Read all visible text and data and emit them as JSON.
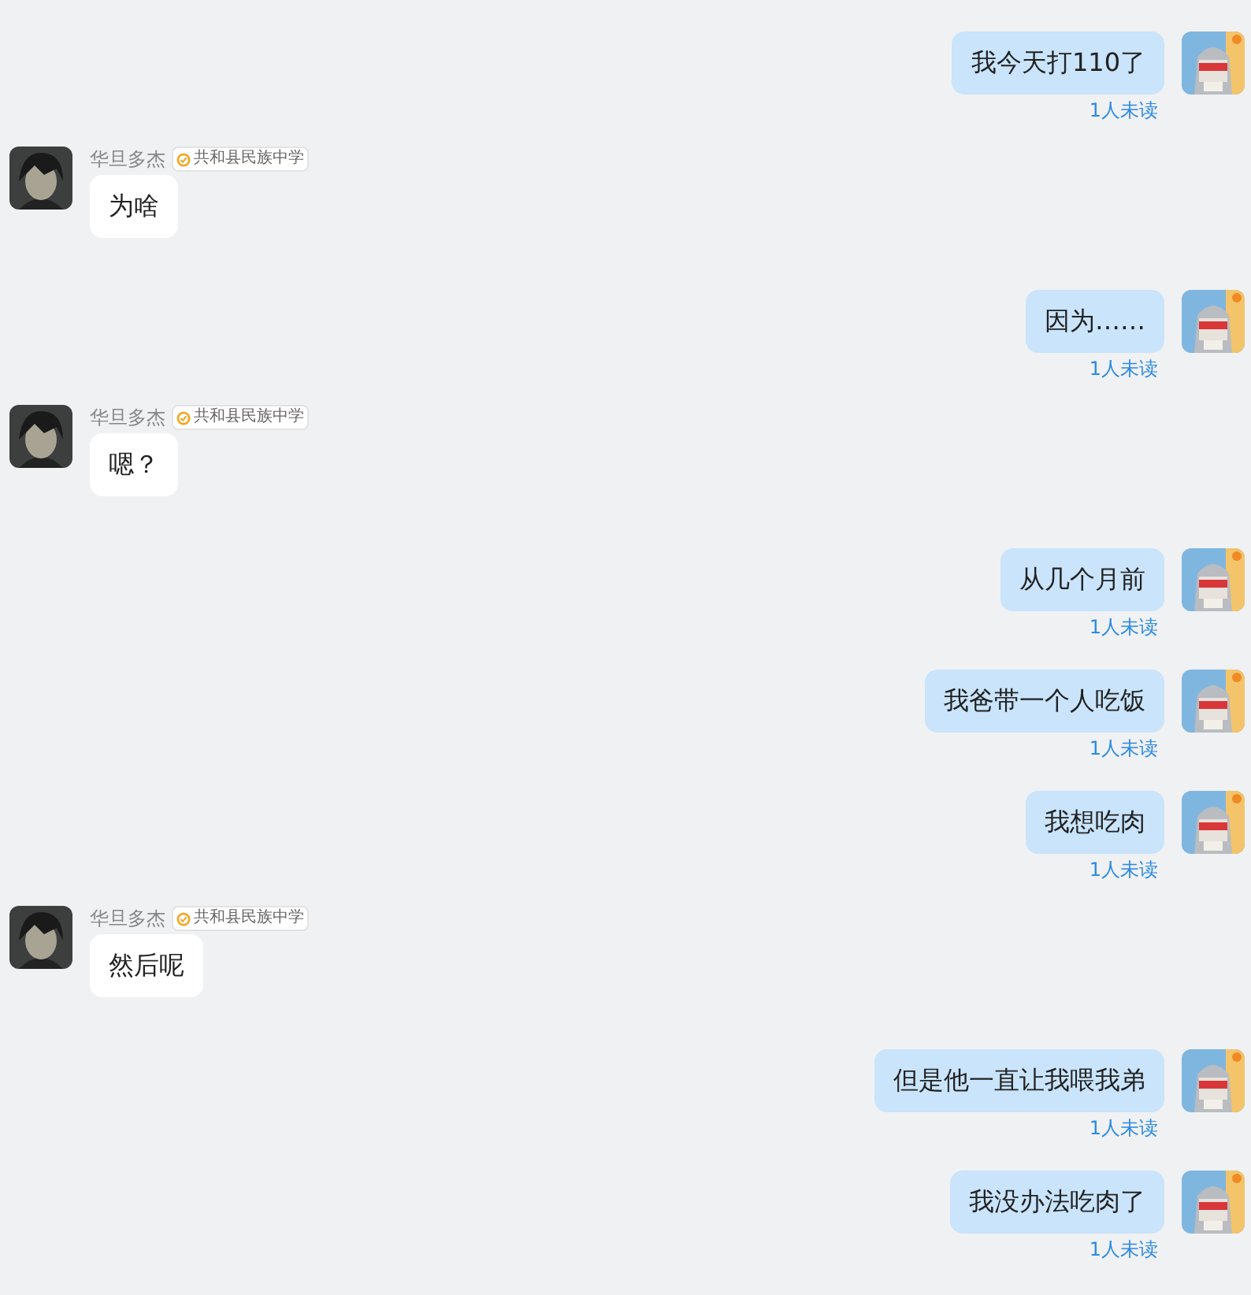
{
  "messages": [
    {
      "kind": "outgoing",
      "text": "我今天打110了",
      "receipt": "1人未读"
    },
    {
      "kind": "incoming",
      "sender": "华旦多杰",
      "badge": "共和县民族中学",
      "text": "为啥"
    },
    {
      "kind": "outgoing",
      "text": "因为……",
      "receipt": "1人未读"
    },
    {
      "kind": "incoming",
      "sender": "华旦多杰",
      "badge": "共和县民族中学",
      "text": "嗯？"
    },
    {
      "kind": "outgoing",
      "text": "从几个月前",
      "receipt": "1人未读"
    },
    {
      "kind": "outgoing",
      "text": "我爸带一个人吃饭",
      "receipt": "1人未读"
    },
    {
      "kind": "outgoing",
      "text": "我想吃肉",
      "receipt": "1人未读"
    },
    {
      "kind": "incoming",
      "sender": "华旦多杰",
      "badge": "共和县民族中学",
      "text": "然后呢"
    },
    {
      "kind": "outgoing",
      "text": "但是他一直让我喂我弟",
      "receipt": "1人未读"
    },
    {
      "kind": "outgoing",
      "text": "我没办法吃肉了",
      "receipt": "1人未读"
    }
  ]
}
